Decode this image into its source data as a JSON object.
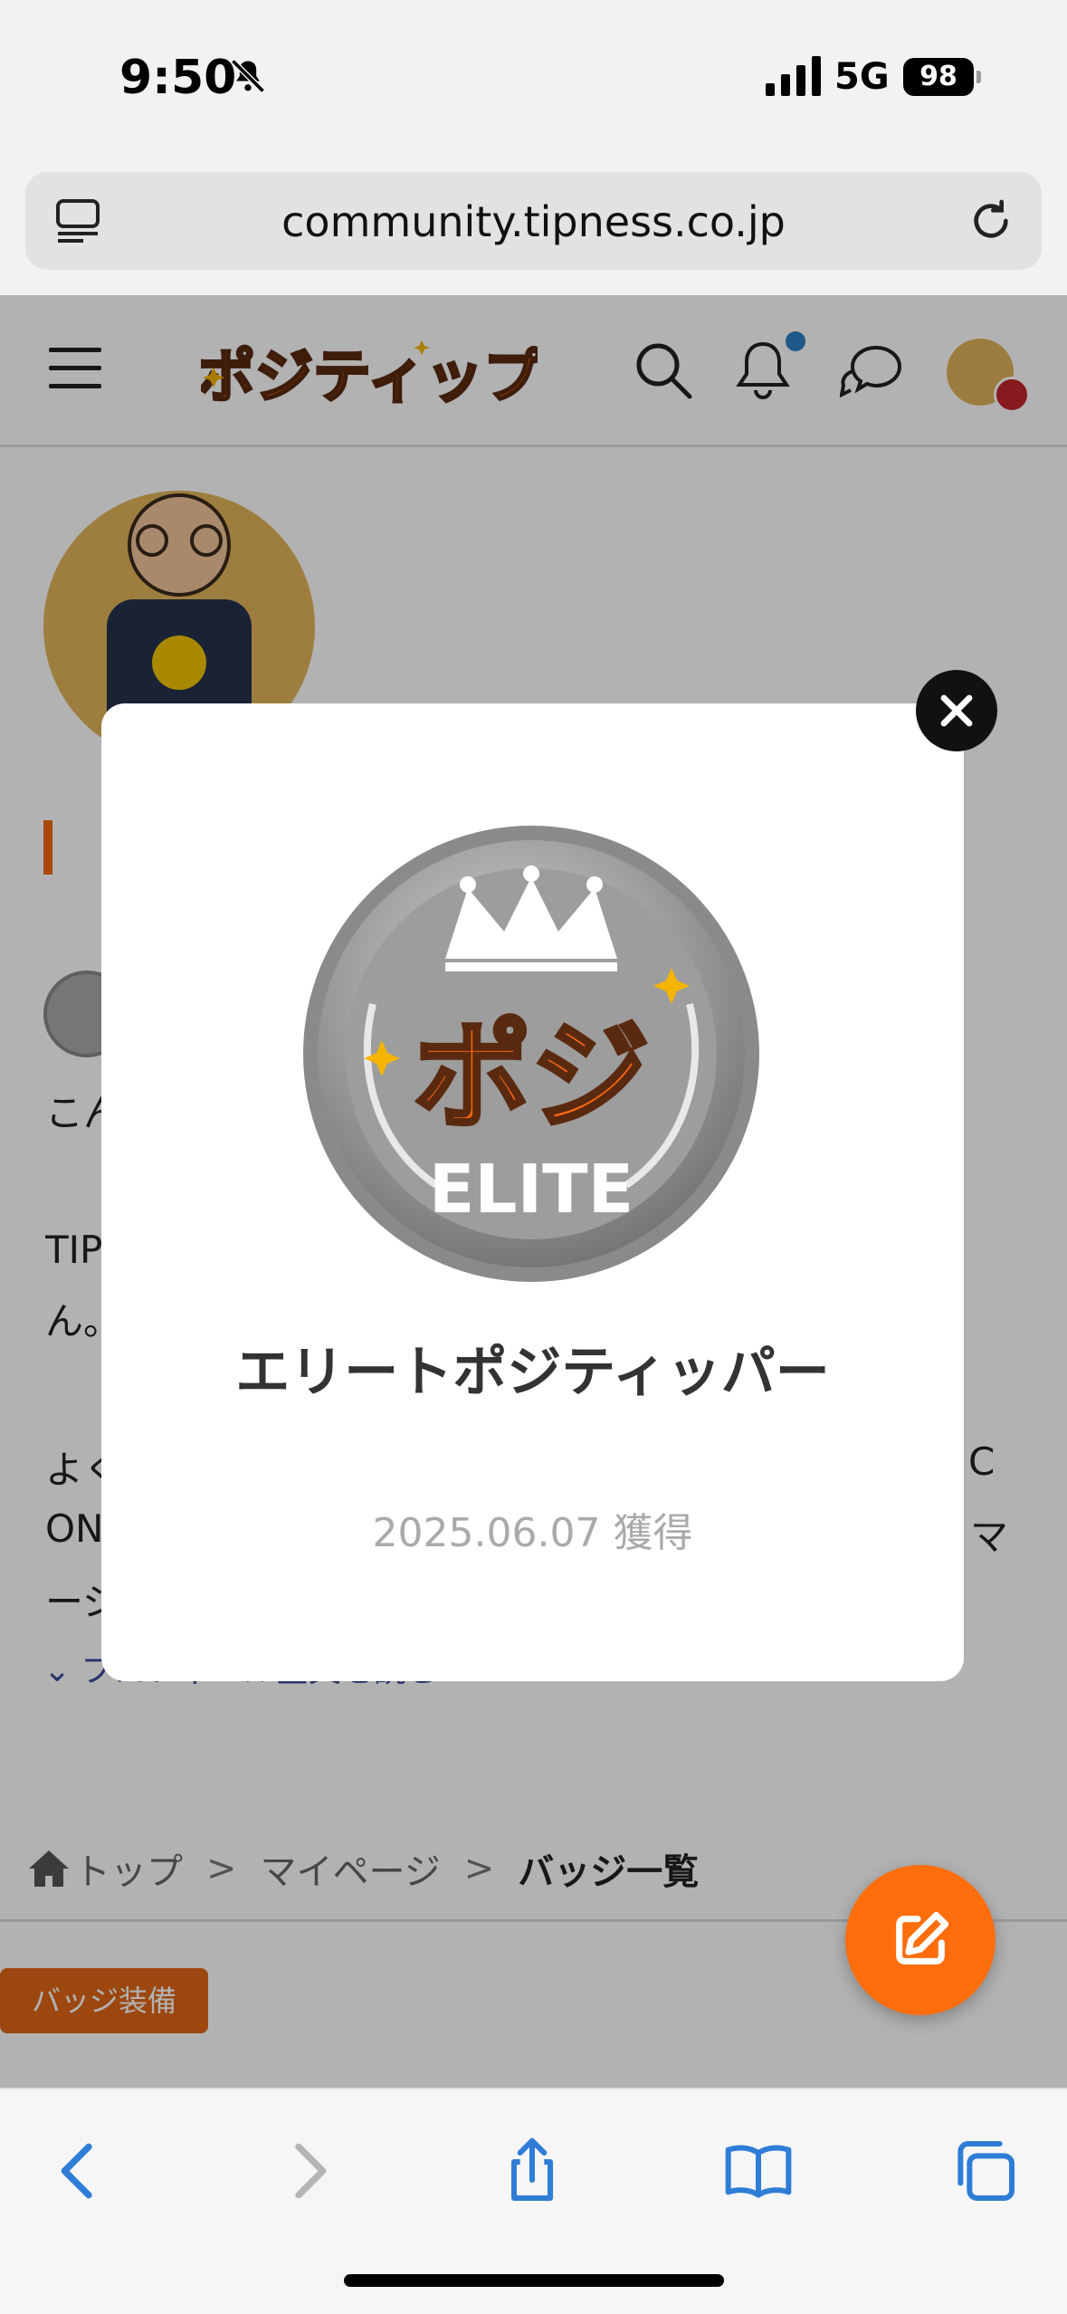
{
  "status_bar": {
    "time": "9:50",
    "network": "5G",
    "battery": "98"
  },
  "browser": {
    "url": "community.tipness.co.jp"
  },
  "site": {
    "logo_text": "ポジティップ"
  },
  "background": {
    "line1": "こん",
    "line2a": "TIP",
    "line2b": "ん。",
    "line3a": "よく",
    "line3_right": "C",
    "line4a": "ON",
    "line4_right": "マ",
    "line5a": "ージ",
    "read_more": "プロフィール全文を読む"
  },
  "breadcrumb": {
    "top": "トップ",
    "mypage": "マイページ",
    "current": "バッジ一覧",
    "separator": ">"
  },
  "equip_button": "バッジ装備",
  "modal": {
    "medal_logo": "ポジ",
    "medal_label": "ELITE",
    "badge_name": "エリートポジティッパー",
    "acquired": "2025.06.07 獲得"
  },
  "colors": {
    "accent": "#ff6d0d",
    "link": "#2f7dd6",
    "overlay": "rgba(0,0,0,0.30)"
  }
}
